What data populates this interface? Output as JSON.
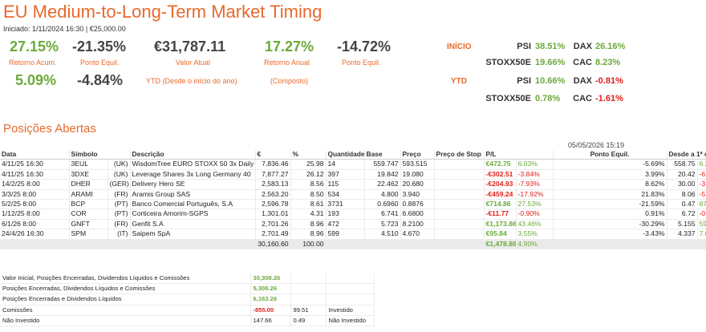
{
  "header": {
    "title": "EU Medium-to-Long-Term Market Timing",
    "subtitle": "Iniciado: 1/11/2024 16:30 | €25,000.00"
  },
  "kpis": {
    "retorno_acum_value": "27.15%",
    "retorno_acum_label": "Retorno Acum.",
    "ponto_equil_value": "-21.35%",
    "ponto_equil_label": "Ponto Equil.",
    "valor_atual_value": "€31,787.11",
    "valor_atual_label": "Valor Atual",
    "retorno_anual_value": "17.27%",
    "retorno_anual_label": "Retorno Anual",
    "ponto_equil2_value": "-14.72%",
    "ponto_equil2_label": "Ponto Equil.",
    "ytd_value": "5.09%",
    "ytd_pe_value": "-4.84%",
    "ytd_label": "YTD (Desde o início do ano)",
    "composto_label": "(Composto)"
  },
  "indices": {
    "inicio_label": "INÍCIO",
    "ytd_label": "YTD",
    "inicio": [
      {
        "name": "PSI",
        "value": "38.51%"
      },
      {
        "name": "DAX",
        "value": "26.16%"
      },
      {
        "name": "STOXX50E",
        "value": "19.66%"
      },
      {
        "name": "CAC",
        "value": "8.23%"
      }
    ],
    "ytd": [
      {
        "name": "PSI",
        "value": "10.66%"
      },
      {
        "name": "DAX",
        "value": "-0.81%"
      },
      {
        "name": "STOXX50E",
        "value": "0.78%"
      },
      {
        "name": "CAC",
        "value": "-1.61%"
      }
    ]
  },
  "positions": {
    "section_title": "Posições Abertas",
    "timestamp": "05/05/2026 15:19",
    "columns": [
      "Data",
      "Símbolo",
      "Descrição",
      "€",
      "%",
      "Quantidade",
      "Base",
      "Preço",
      "Preço de Stop",
      "P/L",
      "Ponto Equil.",
      "Desde a 1ª compra"
    ],
    "rows": [
      {
        "data": "4/11/25 16:30",
        "sym": "3EUL",
        "mkt": "(UK)",
        "desc": "WisdomTree EURO STOXX 50 3x Daily",
        "eur": "7,836.46",
        "pct": "25.98",
        "qty": "14",
        "base": "559.747",
        "price": "593.515",
        "stop": "",
        "pl": "€472.75",
        "plp": "6.03%",
        "pe": "-5.69%",
        "d1": "558.75",
        "d1p": "6.22%"
      },
      {
        "data": "4/11/25 16:30",
        "sym": "3DXE",
        "mkt": "(UK)",
        "desc": "Leverage Shares 3x Long Germany 40",
        "eur": "7,877.27",
        "pct": "26.12",
        "qty": "397",
        "base": "19.842",
        "price": "19.080",
        "stop": "",
        "pl": "-€302.51",
        "plp": "-3.84%",
        "pe": "3.99%",
        "d1": "20.42",
        "d1p": "-6.56%"
      },
      {
        "data": "14/2/25 8:00",
        "sym": "DHER",
        "mkt": "(GER)",
        "desc": "Delivery Hero SE",
        "eur": "2,583.13",
        "pct": "8.56",
        "qty": "115",
        "base": "22.462",
        "price": "20.680",
        "stop": "",
        "pl": "-€204.93",
        "plp": "-7.93%",
        "pe": "8.62%",
        "d1": "30.00",
        "d1p": "-31.07%"
      },
      {
        "data": "3/3/25 8:00",
        "sym": "ARAMI",
        "mkt": "(FR)",
        "desc": "Aramis Group SAS",
        "eur": "2,563.20",
        "pct": "8.50",
        "qty": "534",
        "base": "4.800",
        "price": "3.940",
        "stop": "",
        "pl": "-€459.24",
        "plp": "-17.92%",
        "pe": "21.83%",
        "d1": "8.06",
        "d1p": "-51.12%"
      },
      {
        "data": "5/2/25 8:00",
        "sym": "BCP",
        "mkt": "(PT)",
        "desc": "Banco Comercial Português, S.A",
        "eur": "2,596.78",
        "pct": "8.61",
        "qty": "3731",
        "base": "0.6960",
        "price": "0.8876",
        "stop": "",
        "pl": "€714.86",
        "plp": "27.53%",
        "pe": "-21.59%",
        "d1": "0.47",
        "d1p": "87.93%"
      },
      {
        "data": "1/12/25 8:00",
        "sym": "COR",
        "mkt": "(PT)",
        "desc": "Corticeira Amorim-SGPS",
        "eur": "1,301.01",
        "pct": "4.31",
        "qty": "193",
        "base": "6.741",
        "price": "6.6800",
        "stop": "",
        "pl": "-€11.77",
        "plp": "-0.90%",
        "pe": "0.91%",
        "d1": "6.72",
        "d1p": "-0.60%"
      },
      {
        "data": "6/1/26 8:00",
        "sym": "GNFT",
        "mkt": "(FR)",
        "desc": "Genfit S.A",
        "eur": "2,701.26",
        "pct": "8.96",
        "qty": "472",
        "base": "5.723",
        "price": "8.2100",
        "stop": "",
        "pl": "€1,173.86",
        "plp": "43.46%",
        "pe": "-30.29%",
        "d1": "5.155",
        "d1p": "59.26%"
      },
      {
        "data": "24/4/26 16:30",
        "sym": "SPM",
        "mkt": "(IT)",
        "desc": "Saipem SpA",
        "eur": "2,701.49",
        "pct": "8.96",
        "qty": "599",
        "base": "4.510",
        "price": "4.670",
        "stop": "",
        "pl": "€95.84",
        "plp": "3.55%",
        "pe": "-3.43%",
        "d1": "4.337",
        "d1p": "7.68%"
      }
    ],
    "total_eur": "30,160.60",
    "total_pct": "100.00",
    "total_pl": "€1,478.86",
    "total_plp": "4.90%"
  },
  "summary": [
    {
      "label": "Valor Inicial, Posições Encerradas, Dividendos Líquidos e Comissões",
      "value": "30,308.26",
      "kind": "pos",
      "extra": "",
      "note": ""
    },
    {
      "label": "Posições Encerradas, Dividendos Líquidos e Comissões",
      "value": "5,308.26",
      "kind": "pos",
      "extra": "",
      "note": ""
    },
    {
      "label": "Posições Encerradas e Dividendos Líquidos",
      "value": "6,163.26",
      "kind": "pos",
      "extra": "",
      "note": ""
    },
    {
      "label": "Comissões",
      "value": "-855.00",
      "kind": "neg",
      "extra": "99.51",
      "note": "Investido"
    },
    {
      "label": "Não Investido",
      "value": "147.66",
      "kind": "plain",
      "extra": "0.49",
      "note": "Não Investido"
    }
  ],
  "colors": {
    "accent": "#e8692a",
    "positive": "#6aaa3a",
    "negative": "#e0201a"
  }
}
